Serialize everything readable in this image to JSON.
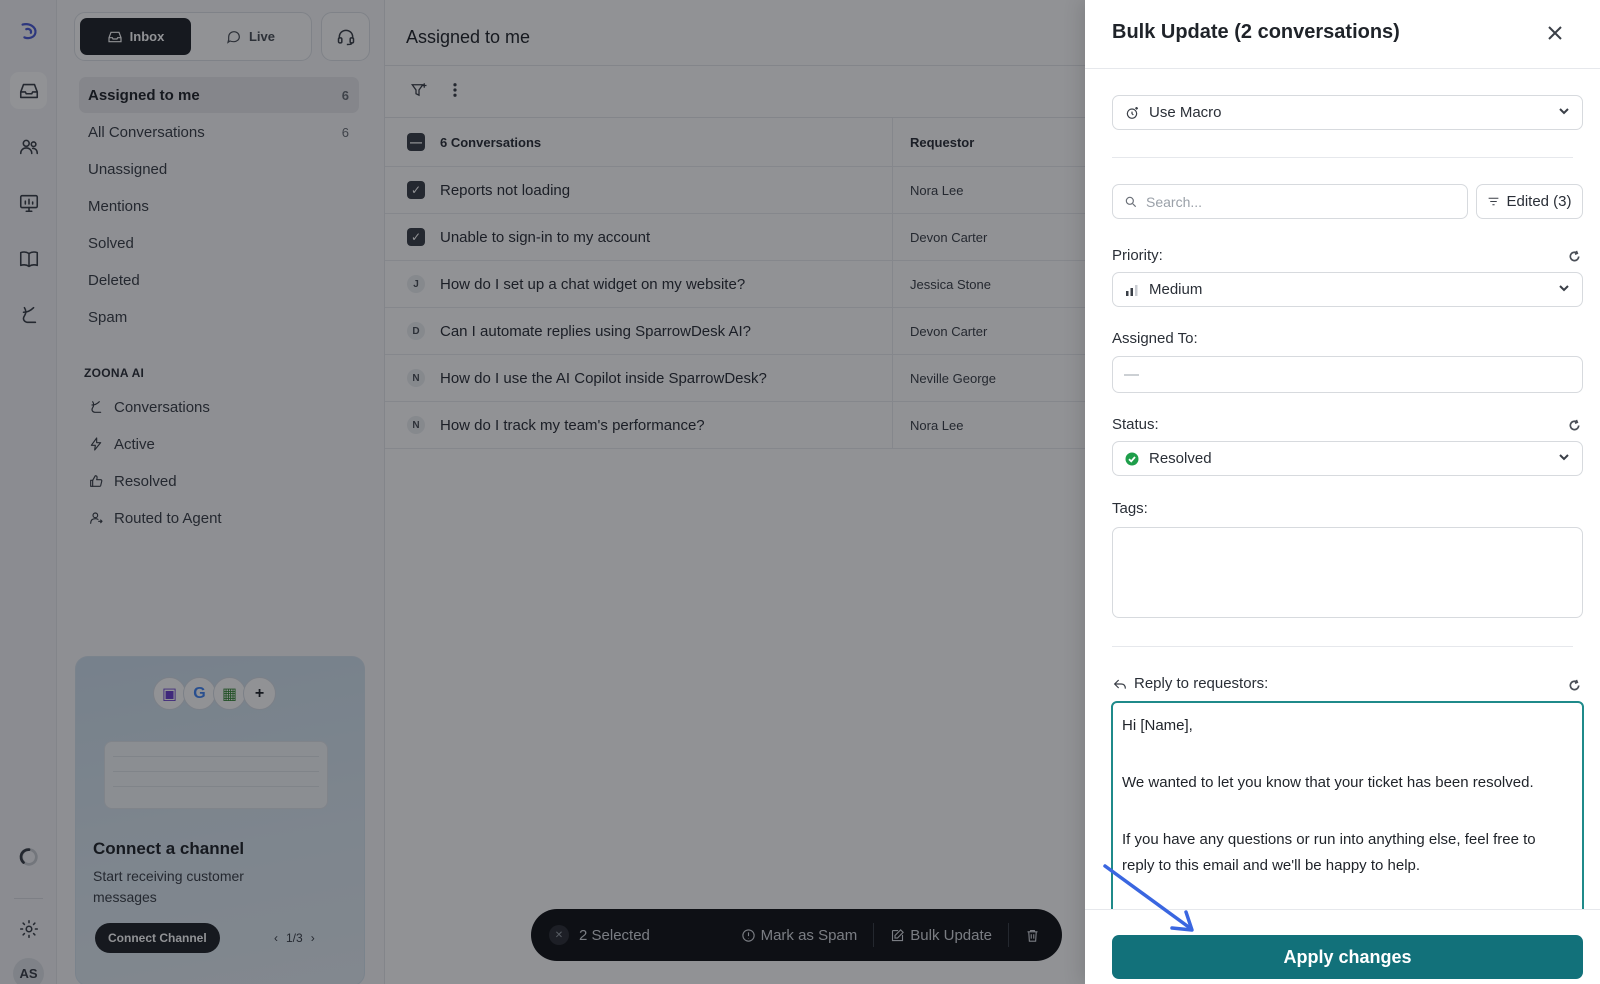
{
  "segment": {
    "inbox_label": "Inbox",
    "live_label": "Live"
  },
  "main": {
    "title": "Assigned to me"
  },
  "nav": {
    "items": [
      {
        "label": "Assigned to me",
        "count": "6"
      },
      {
        "label": "All Conversations",
        "count": "6"
      },
      {
        "label": "Unassigned",
        "count": ""
      },
      {
        "label": "Mentions",
        "count": ""
      },
      {
        "label": "Solved",
        "count": ""
      },
      {
        "label": "Deleted",
        "count": ""
      },
      {
        "label": "Spam",
        "count": ""
      }
    ]
  },
  "ai_section": {
    "heading": "ZOONA AI",
    "items": [
      {
        "label": "Conversations",
        "icon": "zoona-icon"
      },
      {
        "label": "Active",
        "icon": "bolt-icon"
      },
      {
        "label": "Resolved",
        "icon": "thumbs-up-icon"
      },
      {
        "label": "Routed to Agent",
        "icon": "user-route-icon"
      }
    ]
  },
  "promo": {
    "title": "Connect a channel",
    "subtitle": "Start receiving customer messages",
    "button": "Connect Channel",
    "pager": "1/3"
  },
  "rail": {
    "avatar": "AS"
  },
  "table": {
    "header_subject": "6 Conversations",
    "header_requestor": "Requestor",
    "rows": [
      {
        "marker": "",
        "subject": "Reports not loading",
        "requestor": "Nora Lee",
        "checked": true
      },
      {
        "marker": "",
        "subject": "Unable to sign-in to my account",
        "requestor": "Devon Carter",
        "checked": true
      },
      {
        "marker": "J",
        "subject": "How do I set up a chat widget on my website?",
        "requestor": "Jessica Stone",
        "checked": false
      },
      {
        "marker": "D",
        "subject": "Can I automate replies using SparrowDesk AI?",
        "requestor": "Devon Carter",
        "checked": false
      },
      {
        "marker": "N",
        "subject": "How do I use the AI Copilot inside SparrowDesk?",
        "requestor": "Neville George",
        "checked": false
      },
      {
        "marker": "N",
        "subject": "How do I track my team's performance?",
        "requestor": "Nora Lee",
        "checked": false
      }
    ]
  },
  "bulkbar": {
    "selected": "2 Selected",
    "spam": "Mark as Spam",
    "bulk_update": "Bulk Update"
  },
  "drawer": {
    "title": "Bulk Update (2 conversations)",
    "macro": "Use Macro",
    "search_placeholder": "Search...",
    "edited": "Edited (3)",
    "priority_label": "Priority:",
    "priority_value": "Medium",
    "assigned_label": "Assigned To:",
    "assigned_value": "—",
    "status_label": "Status:",
    "status_value": "Resolved",
    "tags_label": "Tags:",
    "reply_label": "Reply to requestors:",
    "reply_lines": [
      "Hi [Name],",
      "We wanted to let you know that your ticket has been resolved.",
      "If you have any questions or run into anything else, feel free to reply to this email and we'll be happy to help."
    ],
    "apply": "Apply changes"
  },
  "colors": {
    "accent": "#12717a",
    "focus": "#1f8a8a",
    "status_green": "#1e9e4a",
    "arrow": "#3a66e0"
  }
}
